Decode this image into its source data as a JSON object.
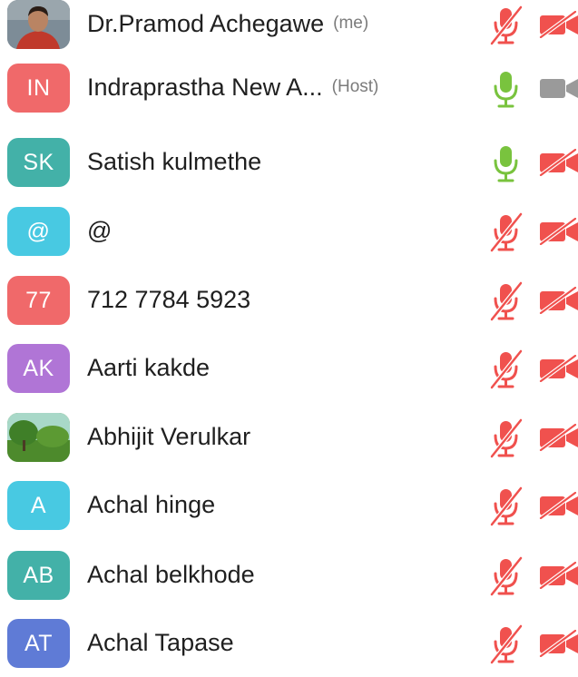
{
  "colors": {
    "muted_red": "#f0514e",
    "unmuted_green": "#79c33e",
    "camera_off_gray": "#9a9a9a",
    "text": "#1f1f1f",
    "tag_text": "#7b7b7b"
  },
  "participants": [
    {
      "name": "Dr.Pramod Achegawe",
      "tag": "(me)",
      "avatar_type": "photo",
      "avatar_text": "",
      "avatar_color": "#6f7f8f",
      "mic": "muted",
      "camera": "off-muted"
    },
    {
      "name": "Indraprastha New A...",
      "tag": "(Host)",
      "avatar_type": "initials",
      "avatar_text": "IN",
      "avatar_color": "#f0696a",
      "mic": "on",
      "camera": "off-gray"
    },
    {
      "name": "Satish kulmethe",
      "tag": "",
      "avatar_type": "initials",
      "avatar_text": "SK",
      "avatar_color": "#43b1a8",
      "mic": "on",
      "camera": "off-muted"
    },
    {
      "name": "@",
      "tag": "",
      "avatar_type": "initials",
      "avatar_text": "@",
      "avatar_color": "#48c9e2",
      "mic": "muted",
      "camera": "off-muted"
    },
    {
      "name": "712 7784 5923",
      "tag": "",
      "avatar_type": "initials",
      "avatar_text": "77",
      "avatar_color": "#f0696a",
      "mic": "muted",
      "camera": "off-muted"
    },
    {
      "name": "Aarti kakde",
      "tag": "",
      "avatar_type": "initials",
      "avatar_text": "AK",
      "avatar_color": "#b075d6",
      "mic": "muted",
      "camera": "off-muted"
    },
    {
      "name": "Abhijit Verulkar",
      "tag": "",
      "avatar_type": "photo",
      "avatar_text": "",
      "avatar_color": "#5f8f3a",
      "mic": "muted",
      "camera": "off-muted"
    },
    {
      "name": "Achal  hinge",
      "tag": "",
      "avatar_type": "initials",
      "avatar_text": "A",
      "avatar_color": "#48c9e2",
      "mic": "muted",
      "camera": "off-muted"
    },
    {
      "name": "Achal belkhode",
      "tag": "",
      "avatar_type": "initials",
      "avatar_text": "AB",
      "avatar_color": "#43b1a8",
      "mic": "muted",
      "camera": "off-muted"
    },
    {
      "name": "Achal Tapase",
      "tag": "",
      "avatar_type": "initials",
      "avatar_text": "AT",
      "avatar_color": "#5f7bd6",
      "mic": "muted",
      "camera": "off-muted"
    }
  ]
}
